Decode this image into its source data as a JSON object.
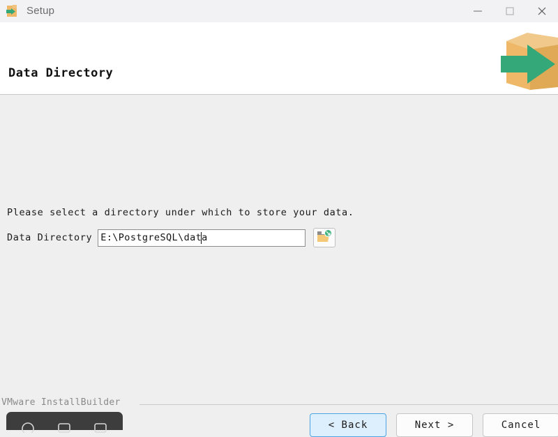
{
  "window": {
    "title": "Setup",
    "icon": "installer-box-icon",
    "controls": [
      {
        "name": "minimize-button",
        "glyph": "minimize-icon"
      },
      {
        "name": "maximize-button",
        "glyph": "maximize-icon"
      },
      {
        "name": "close-button",
        "glyph": "close-icon"
      }
    ]
  },
  "header": {
    "heading": "Data Directory",
    "art": "open-box-green-arrow-icon"
  },
  "main": {
    "instruction": "Please select a directory under which to store your data.",
    "field": {
      "label": "Data Directory",
      "value": "E:\\PostgreSQL\\data",
      "placeholder": "",
      "browse_icon": "folder-browse-icon"
    }
  },
  "footer": {
    "brand": "VMware InstallBuilder",
    "buttons": {
      "back": "< Back",
      "next": "Next >",
      "cancel": "Cancel"
    }
  },
  "colors": {
    "window_bg": "#efefef",
    "titlebar_bg": "#f2f2f4",
    "header_bg": "#ffffff",
    "accent_green": "#35a879",
    "accent_tan": "#eeb868",
    "focus_blue": "#4ba3e3",
    "focus_fill": "#ddeefc",
    "dock_bg": "#3d3d3d"
  }
}
